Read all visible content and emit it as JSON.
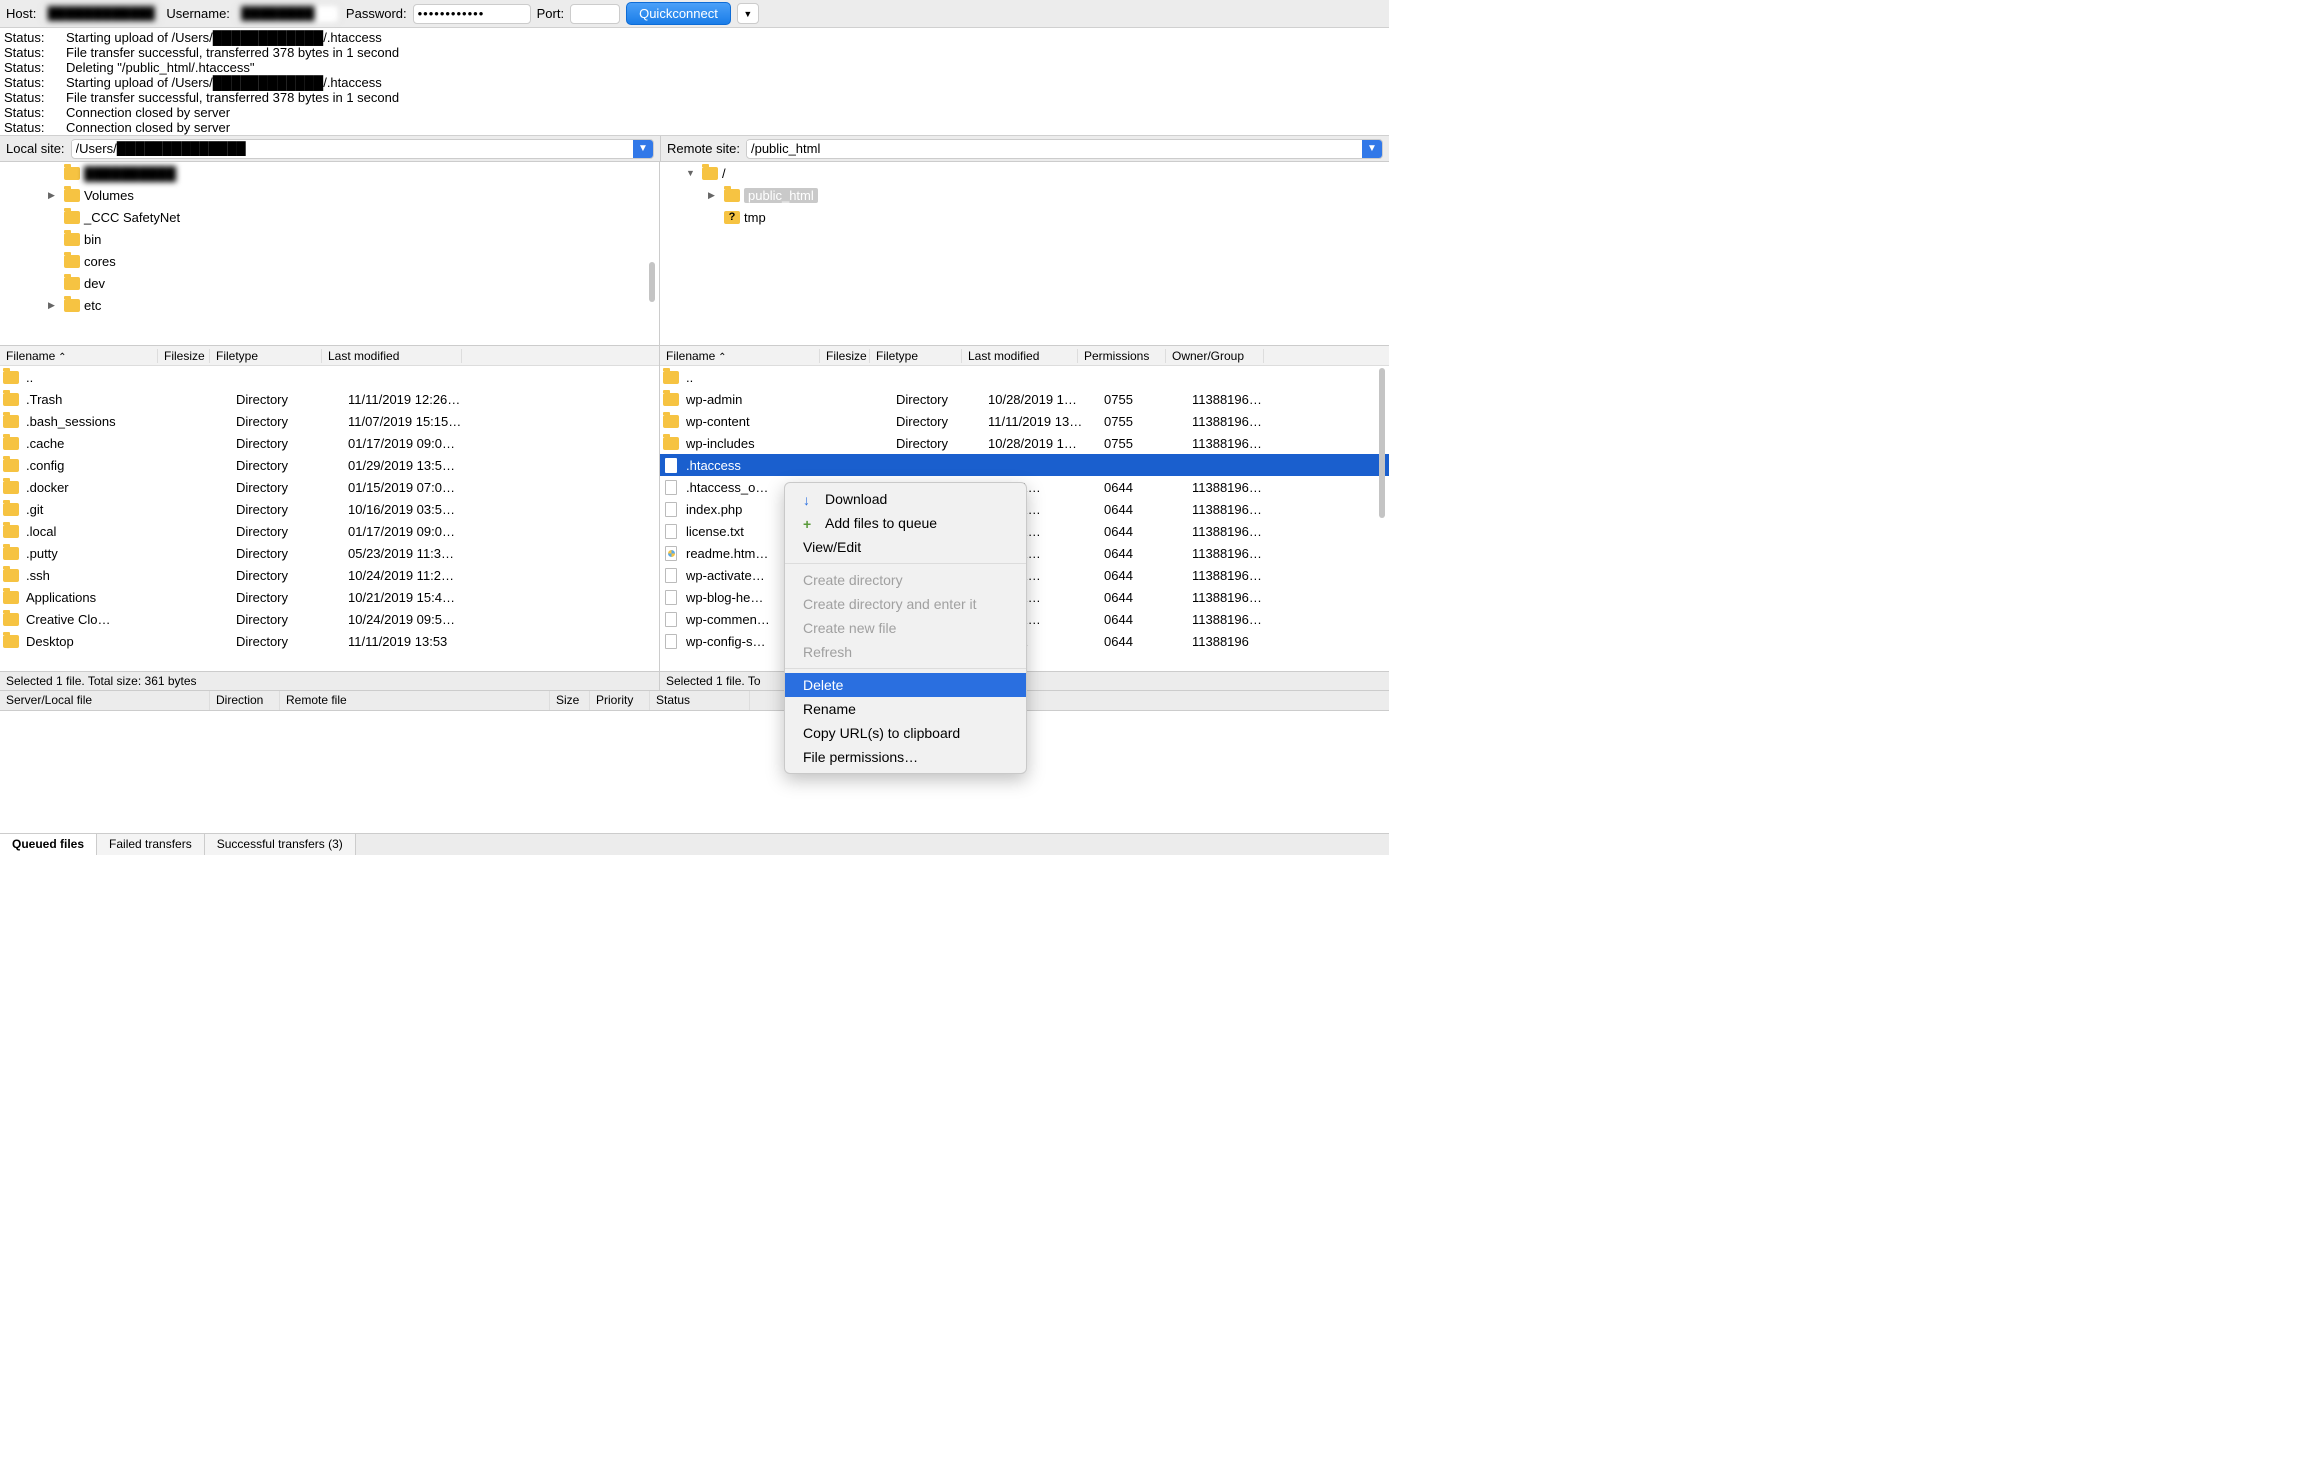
{
  "toolbar": {
    "host_label": "Host:",
    "host_value": "████████████",
    "username_label": "Username:",
    "username_value": "████████",
    "password_label": "Password:",
    "password_value": "••••••••••••",
    "port_label": "Port:",
    "port_value": "",
    "quickconnect": "Quickconnect"
  },
  "log": [
    {
      "label": "Status:",
      "msg": "Starting upload of /Users/████████████/.htaccess"
    },
    {
      "label": "Status:",
      "msg": "File transfer successful, transferred 378 bytes in 1 second"
    },
    {
      "label": "Status:",
      "msg": "Deleting \"/public_html/.htaccess\""
    },
    {
      "label": "Status:",
      "msg": "Starting upload of /Users/████████████/.htaccess"
    },
    {
      "label": "Status:",
      "msg": "File transfer successful, transferred 378 bytes in 1 second"
    },
    {
      "label": "Status:",
      "msg": "Connection closed by server"
    },
    {
      "label": "Status:",
      "msg": "Connection closed by server"
    }
  ],
  "sites": {
    "local_label": "Local site:",
    "local_path": "/Users/██████████████",
    "remote_label": "Remote site:",
    "remote_path": "/public_html"
  },
  "local_tree": [
    {
      "indent": 1,
      "tri": "",
      "name": "██████████",
      "blur": true
    },
    {
      "indent": 1,
      "tri": "▶",
      "name": "Volumes"
    },
    {
      "indent": 1,
      "tri": "",
      "name": "_CCC SafetyNet"
    },
    {
      "indent": 1,
      "tri": "",
      "name": "bin"
    },
    {
      "indent": 1,
      "tri": "",
      "name": "cores"
    },
    {
      "indent": 1,
      "tri": "",
      "name": "dev"
    },
    {
      "indent": 1,
      "tri": "▶",
      "name": "etc"
    }
  ],
  "remote_tree": [
    {
      "indent": 0,
      "tri": "▼",
      "name": "/",
      "type": "folder"
    },
    {
      "indent": 1,
      "tri": "▶",
      "name": "public_html",
      "type": "folder",
      "sel": true
    },
    {
      "indent": 1,
      "tri": "",
      "name": "tmp",
      "type": "q"
    }
  ],
  "local_cols": [
    "Filename",
    "Filesize",
    "Filetype",
    "Last modified"
  ],
  "local_files": [
    {
      "name": "..",
      "type": "",
      "mod": "",
      "ico": "folder"
    },
    {
      "name": ".Trash",
      "type": "Directory",
      "mod": "11/11/2019 12:26…",
      "ico": "folder"
    },
    {
      "name": ".bash_sessions",
      "type": "Directory",
      "mod": "11/07/2019 15:15…",
      "ico": "folder"
    },
    {
      "name": ".cache",
      "type": "Directory",
      "mod": "01/17/2019 09:0…",
      "ico": "folder"
    },
    {
      "name": ".config",
      "type": "Directory",
      "mod": "01/29/2019 13:5…",
      "ico": "folder"
    },
    {
      "name": ".docker",
      "type": "Directory",
      "mod": "01/15/2019 07:0…",
      "ico": "folder"
    },
    {
      "name": ".git",
      "type": "Directory",
      "mod": "10/16/2019 03:5…",
      "ico": "folder"
    },
    {
      "name": ".local",
      "type": "Directory",
      "mod": "01/17/2019 09:0…",
      "ico": "folder"
    },
    {
      "name": ".putty",
      "type": "Directory",
      "mod": "05/23/2019 11:3…",
      "ico": "folder"
    },
    {
      "name": ".ssh",
      "type": "Directory",
      "mod": "10/24/2019 11:2…",
      "ico": "folder"
    },
    {
      "name": "Applications",
      "type": "Directory",
      "mod": "10/21/2019 15:4…",
      "ico": "folder"
    },
    {
      "name": "Creative Clo…",
      "type": "Directory",
      "mod": "10/24/2019 09:5…",
      "ico": "folder"
    },
    {
      "name": "Desktop",
      "type": "Directory",
      "mod": "11/11/2019 13:53",
      "ico": "folder"
    }
  ],
  "remote_cols": [
    "Filename",
    "Filesize",
    "Filetype",
    "Last modified",
    "Permissions",
    "Owner/Group"
  ],
  "remote_files": [
    {
      "name": "..",
      "type": "",
      "mod": "",
      "perm": "",
      "own": "",
      "ico": "folder"
    },
    {
      "name": "wp-admin",
      "type": "Directory",
      "mod": "10/28/2019 1…",
      "perm": "0755",
      "own": "11388196…",
      "ico": "folder"
    },
    {
      "name": "wp-content",
      "type": "Directory",
      "mod": "11/11/2019 13…",
      "perm": "0755",
      "own": "11388196…",
      "ico": "folder"
    },
    {
      "name": "wp-includes",
      "type": "Directory",
      "mod": "10/28/2019 1…",
      "perm": "0755",
      "own": "11388196…",
      "ico": "folder"
    },
    {
      "name": ".htaccess",
      "type": "",
      "mod": "",
      "perm": "",
      "own": "",
      "ico": "file",
      "sel": true
    },
    {
      "name": ".htaccess_o…",
      "type": "",
      "mod": "2019 1…",
      "perm": "0644",
      "own": "11388196…",
      "ico": "file"
    },
    {
      "name": "index.php",
      "type": "",
      "mod": "2019 1…",
      "perm": "0644",
      "own": "11388196…",
      "ico": "file"
    },
    {
      "name": "license.txt",
      "type": "",
      "mod": "2019 1…",
      "perm": "0644",
      "own": "11388196…",
      "ico": "file"
    },
    {
      "name": "readme.htm…",
      "type": "",
      "mod": "2019 1…",
      "perm": "0644",
      "own": "11388196…",
      "ico": "html"
    },
    {
      "name": "wp-activate…",
      "type": "",
      "mod": "2019 1…",
      "perm": "0644",
      "own": "11388196…",
      "ico": "file"
    },
    {
      "name": "wp-blog-he…",
      "type": "",
      "mod": "2019 1…",
      "perm": "0644",
      "own": "11388196…",
      "ico": "file"
    },
    {
      "name": "wp-commen…",
      "type": "",
      "mod": "2019 1…",
      "perm": "0644",
      "own": "11388196…",
      "ico": "file"
    },
    {
      "name": "wp-config-s…",
      "type": "",
      "mod": "2019 1",
      "perm": "0644",
      "own": "11388196",
      "ico": "file"
    }
  ],
  "status": {
    "left": "Selected 1 file. Total size: 361 bytes",
    "right": "Selected 1 file. To"
  },
  "queue_cols": [
    "Server/Local file",
    "Direction",
    "Remote file",
    "Size",
    "Priority",
    "Status"
  ],
  "tabs": {
    "queued": "Queued files",
    "failed": "Failed transfers",
    "success": "Successful transfers (3)"
  },
  "ctx": {
    "download": "Download",
    "addqueue": "Add files to queue",
    "viewedit": "View/Edit",
    "createdir": "Create directory",
    "createdir_enter": "Create directory and enter it",
    "newfile": "Create new file",
    "refresh": "Refresh",
    "delete": "Delete",
    "rename": "Rename",
    "copyurl": "Copy URL(s) to clipboard",
    "fileperm": "File permissions…"
  }
}
